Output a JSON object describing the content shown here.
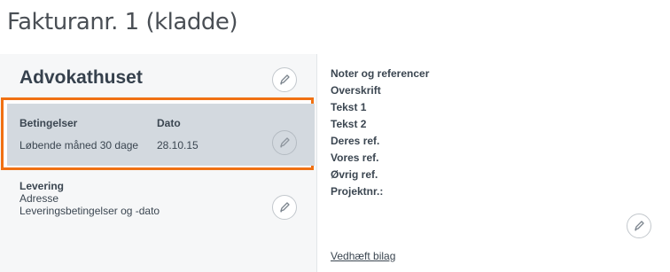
{
  "page": {
    "title": "Fakturanr. 1 (kladde)"
  },
  "customer": {
    "name": "Advokathuset"
  },
  "terms": {
    "conditions_label": "Betingelser",
    "date_label": "Dato",
    "conditions_value": "Løbende måned 30 dage",
    "date_value": "28.10.15"
  },
  "delivery": {
    "heading": "Levering",
    "address_label": "Adresse",
    "terms_label": "Leveringsbetingelser og -dato"
  },
  "notes": {
    "items": [
      "Noter og referencer",
      "Overskrift",
      "Tekst 1",
      "Tekst 2",
      "Deres ref.",
      "Vores ref.",
      "Øvrig ref.",
      "Projektnr.:"
    ],
    "attach_link": "Vedhæft bilag"
  },
  "colors": {
    "highlight_border": "#f07113",
    "terms_background": "#d3d9df",
    "card_background": "#f6f7f8"
  },
  "icons": {
    "edit": "pencil-icon"
  }
}
